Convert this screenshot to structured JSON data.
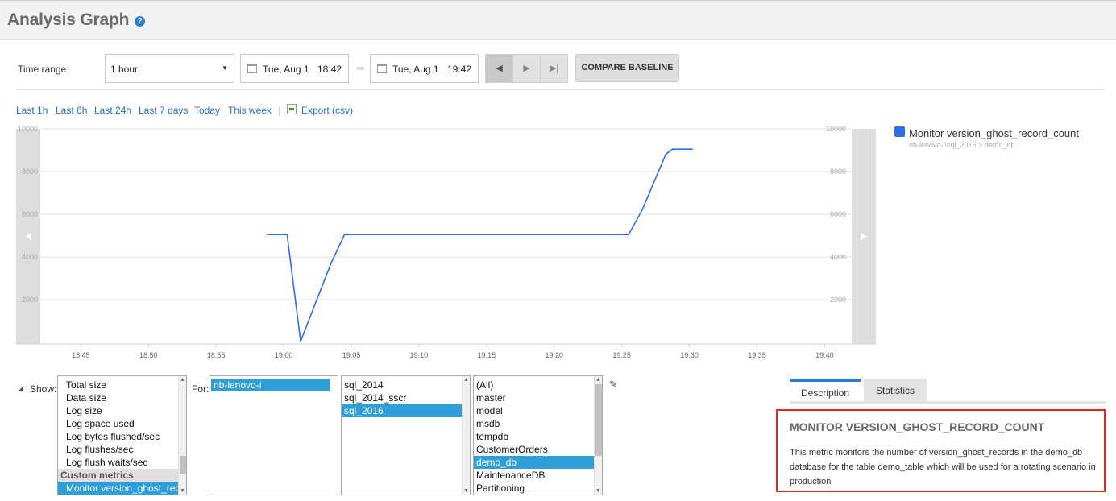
{
  "header": {
    "title": "Analysis Graph",
    "help_icon": "question-circle-icon"
  },
  "toolbar": {
    "time_range_label": "Time range:",
    "time_range_value": "1 hour",
    "start_date": "Tue, Aug 1",
    "start_time": "18:42",
    "end_date": "Tue, Aug 1",
    "end_time": "19:42",
    "compare_baseline": "COMPARE BASELINE"
  },
  "quick_links": [
    "Last 1h",
    "Last 6h",
    "Last 24h",
    "Last 7 days",
    "Today",
    "This week"
  ],
  "export_label": "Export (csv)",
  "chart_data": {
    "type": "line",
    "x_ticks": [
      "18:45",
      "18:50",
      "18:55",
      "19:00",
      "19:05",
      "19:10",
      "19:15",
      "19:20",
      "19:25",
      "19:30",
      "19:35",
      "19:40"
    ],
    "y_ticks": [
      2000,
      4000,
      6000,
      8000,
      10000
    ],
    "ylim": [
      0,
      10000
    ],
    "xlim": [
      "18:42",
      "19:42"
    ],
    "grid": true,
    "legend_position": "right",
    "series": [
      {
        "name": "Monitor version_ghost_record_count",
        "subtitle": "nb-lenovo-i\\sql_2016 > demo_db",
        "color": "#2d6ee6",
        "points": [
          [
            "18:58:45",
            5050
          ],
          [
            "19:00:15",
            5050
          ],
          [
            "19:01:15",
            50
          ],
          [
            "19:03:30",
            3700
          ],
          [
            "19:04:30",
            5050
          ],
          [
            "19:25:30",
            5050
          ],
          [
            "19:26:30",
            6200
          ],
          [
            "19:28:15",
            8800
          ],
          [
            "19:28:45",
            9050
          ],
          [
            "19:30:15",
            9050
          ]
        ]
      }
    ]
  },
  "show_panel": {
    "show_label": "Show:",
    "for_label": "For:",
    "metrics": [
      "Total size",
      "Data size",
      "Log size",
      "Log space used",
      "Log bytes flushed/sec",
      "Log flushes/sec",
      "Log flush waits/sec"
    ],
    "custom_group": "Custom metrics",
    "custom_selected": "Monitor version_ghost_record_count",
    "hosts": [
      "nb-lenovo-i"
    ],
    "instances": [
      "sql_2014",
      "sql_2014_sscr",
      "sql_2016"
    ],
    "databases": [
      "(All)",
      "master",
      "model",
      "msdb",
      "tempdb",
      "CustomerOrders",
      "demo_db",
      "MaintenanceDB",
      "Partitioning"
    ]
  },
  "info_panel": {
    "tabs": [
      "Description",
      "Statistics"
    ],
    "title": "MONITOR VERSION_GHOST_RECORD_COUNT",
    "text": "This metric monitors the number of version_ghost_records in the demo_db database for the table demo_table which will be used for a rotating scenario in production"
  }
}
